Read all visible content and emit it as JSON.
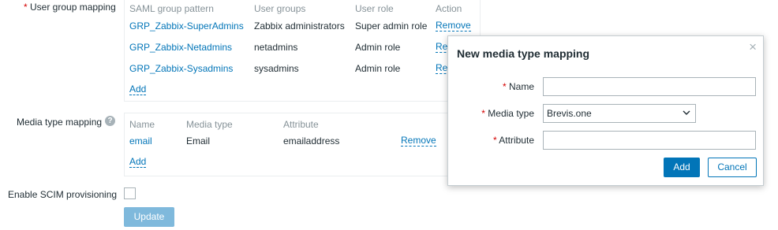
{
  "form": {
    "user_group_mapping_label": "User group mapping",
    "media_type_mapping_label": "Media type mapping",
    "enable_scim_label": "Enable SCIM provisioning",
    "update_label": "Update",
    "help_glyph": "?"
  },
  "user_group_table": {
    "headers": [
      "SAML group pattern",
      "User groups",
      "User role",
      "Action"
    ],
    "rows": [
      {
        "pattern": "GRP_Zabbix-SuperAdmins",
        "groups": "Zabbix administrators",
        "role": "Super admin role",
        "action": "Remove"
      },
      {
        "pattern": "GRP_Zabbix-Netadmins",
        "groups": "netadmins",
        "role": "Admin role",
        "action": "Remove"
      },
      {
        "pattern": "GRP_Zabbix-Sysadmins",
        "groups": "sysadmins",
        "role": "Admin role",
        "action": "Remove"
      }
    ],
    "add_label": "Add"
  },
  "media_type_table": {
    "headers": [
      "Name",
      "Media type",
      "Attribute"
    ],
    "rows": [
      {
        "name": "email",
        "media_type": "Email",
        "attribute": "emailaddress",
        "action": "Remove"
      }
    ],
    "add_label": "Add"
  },
  "dialog": {
    "title": "New media type mapping",
    "close_glyph": "×",
    "name_label": "Name",
    "name_value": "",
    "media_type_label": "Media type",
    "media_type_selected": "Brevis.one",
    "attribute_label": "Attribute",
    "attribute_value": "",
    "add_label": "Add",
    "cancel_label": "Cancel"
  },
  "required_marker": "*",
  "colors": {
    "link": "#0275b8",
    "primary": "#0275b8",
    "disabled_primary": "#7fb9dc",
    "required": "#d40000",
    "header_text": "#869298",
    "border": "#ebeef0"
  },
  "icons": {
    "help": "question-circle-icon",
    "close": "close-icon",
    "chevron": "chevron-down-icon"
  }
}
